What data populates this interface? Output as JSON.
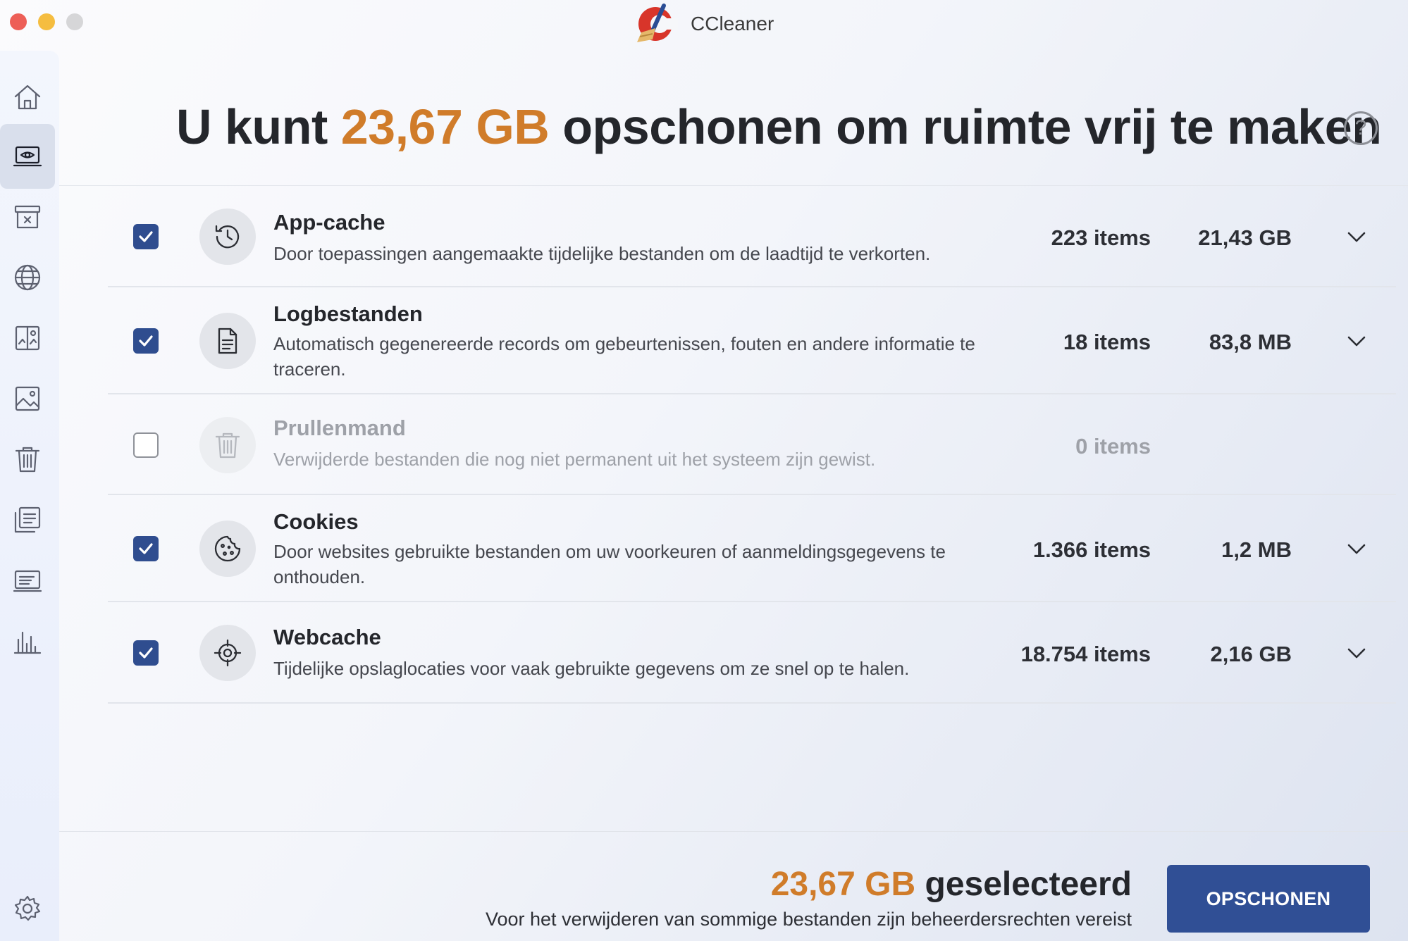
{
  "window": {
    "title": "CCleaner"
  },
  "sidebar": {
    "items": [
      {
        "icon": "home-icon"
      },
      {
        "icon": "health-check-icon",
        "active": true
      },
      {
        "icon": "app-cleaner-icon"
      },
      {
        "icon": "browser-icon"
      },
      {
        "icon": "duplicate-finder-icon"
      },
      {
        "icon": "photo-icon"
      },
      {
        "icon": "trash-icon"
      },
      {
        "icon": "startup-items-icon"
      },
      {
        "icon": "disk-icon"
      },
      {
        "icon": "performance-icon"
      }
    ],
    "settings_icon": "gear-icon"
  },
  "header": {
    "title_prefix": "U kunt ",
    "title_highlight": "23,67 GB",
    "title_suffix": " opschonen om ruimte vrij te maken",
    "help_label": "?"
  },
  "rows": [
    {
      "title": "App-cache",
      "description": "Door toepassingen aangemaakte tijdelijke bestanden om de laadtijd te verkorten.",
      "items": "223 items",
      "size": "21,43 GB",
      "checked": true,
      "icon": "history-icon"
    },
    {
      "title": "Logbestanden",
      "description": "Automatisch gegenereerde records om gebeurtenissen, fouten en andere informatie te traceren.",
      "items": "18 items",
      "size": "83,8 MB",
      "checked": true,
      "icon": "document-icon"
    },
    {
      "title": "Prullenmand",
      "description": "Verwijderde bestanden die nog niet permanent uit het systeem zijn gewist.",
      "items": "0 items",
      "size": "",
      "checked": false,
      "icon": "trash-icon"
    },
    {
      "title": "Cookies",
      "description": "Door websites gebruikte bestanden om uw voorkeuren of aanmeldingsgegevens te onthouden.",
      "items": "1.366 items",
      "size": "1,2 MB",
      "checked": true,
      "icon": "cookie-icon"
    },
    {
      "title": "Webcache",
      "description": "Tijdelijke opslaglocaties voor vaak gebruikte gegevens om ze snel op te halen.",
      "items": "18.754 items",
      "size": "2,16 GB",
      "checked": true,
      "icon": "target-icon"
    }
  ],
  "footer": {
    "selected_amount": "23,67 GB",
    "selected_label": " geselecteerd",
    "note": "Voor het verwijderen van sommige bestanden zijn beheerdersrechten vereist",
    "button_label": "OPSCHONEN"
  },
  "colors": {
    "accent": "#d07c2a",
    "primary_button": "#304f95",
    "checkbox": "#2f4d8f"
  }
}
